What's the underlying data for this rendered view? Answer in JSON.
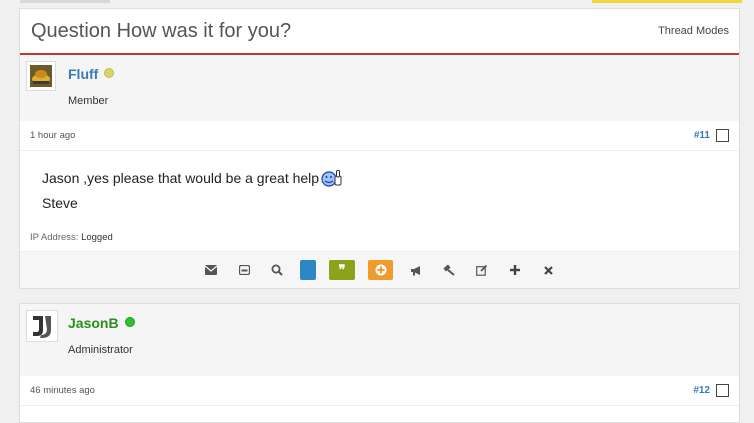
{
  "thread": {
    "title": "Question How was it for you?",
    "modes_label": "Thread Modes"
  },
  "posts": [
    {
      "author": "Fluff",
      "author_color": "#3a7ab4",
      "status": "away",
      "role": "Member",
      "time": "1 hour ago",
      "post_number": "#11",
      "body_line1": "Jason ,yes please that would be a great help",
      "body_line2": "Steve",
      "ip_label": "IP Address:",
      "ip_value": "Logged",
      "actions": [
        "envelope-icon",
        "mail-icon",
        "search-icon",
        "blue-button",
        "quote-button",
        "plus-circle-button",
        "megaphone-icon",
        "gavel-icon",
        "edit-icon",
        "plus-icon",
        "close-icon"
      ]
    },
    {
      "author": "JasonB",
      "author_color": "#2a8f1f",
      "status": "online",
      "role": "Administrator",
      "time": "46 minutes ago",
      "post_number": "#12"
    }
  ],
  "colors": {
    "accent_red": "#c0392b",
    "link_blue": "#3a7ab4",
    "quote_green": "#8aa31b",
    "orange": "#ef9b2e",
    "blue_btn": "#2e86c7"
  }
}
